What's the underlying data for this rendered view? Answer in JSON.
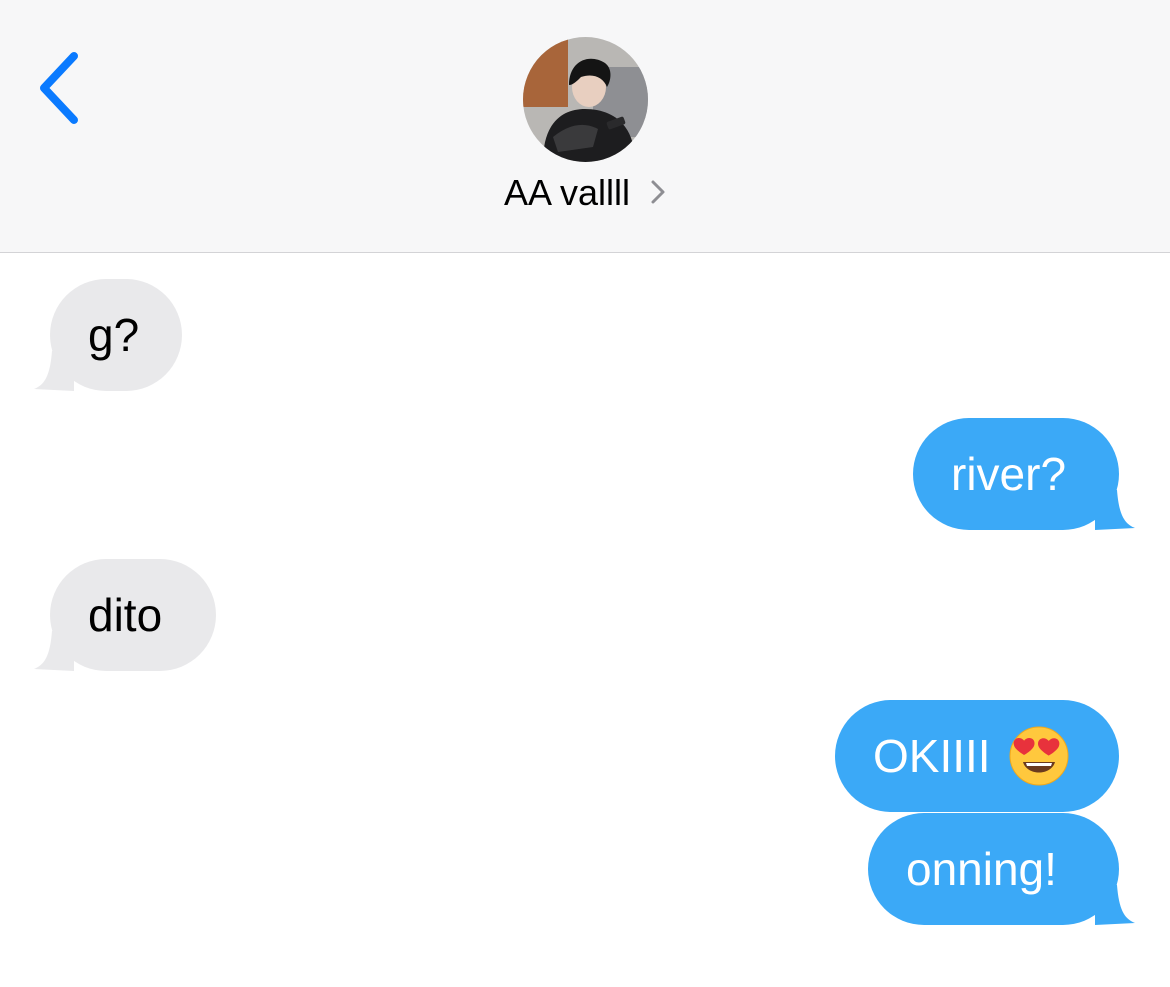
{
  "header": {
    "contact_name": "AA vallll",
    "icons": {
      "back": "chevron-left-icon",
      "details": "chevron-right-icon",
      "avatar": "contact-avatar-photo"
    },
    "colors": {
      "accent": "#0a7aff",
      "background": "#f7f7f8"
    }
  },
  "messages": [
    {
      "direction": "incoming",
      "text": "g?"
    },
    {
      "direction": "outgoing",
      "text": "river?"
    },
    {
      "direction": "incoming",
      "text": "dito"
    },
    {
      "direction": "outgoing",
      "text": "OKIIII",
      "emoji": "heart-eyes-emoji"
    },
    {
      "direction": "outgoing",
      "text": "onning!"
    }
  ],
  "colors": {
    "incoming_bubble": "#e9e9eb",
    "outgoing_bubble": "#3ba9f7"
  }
}
